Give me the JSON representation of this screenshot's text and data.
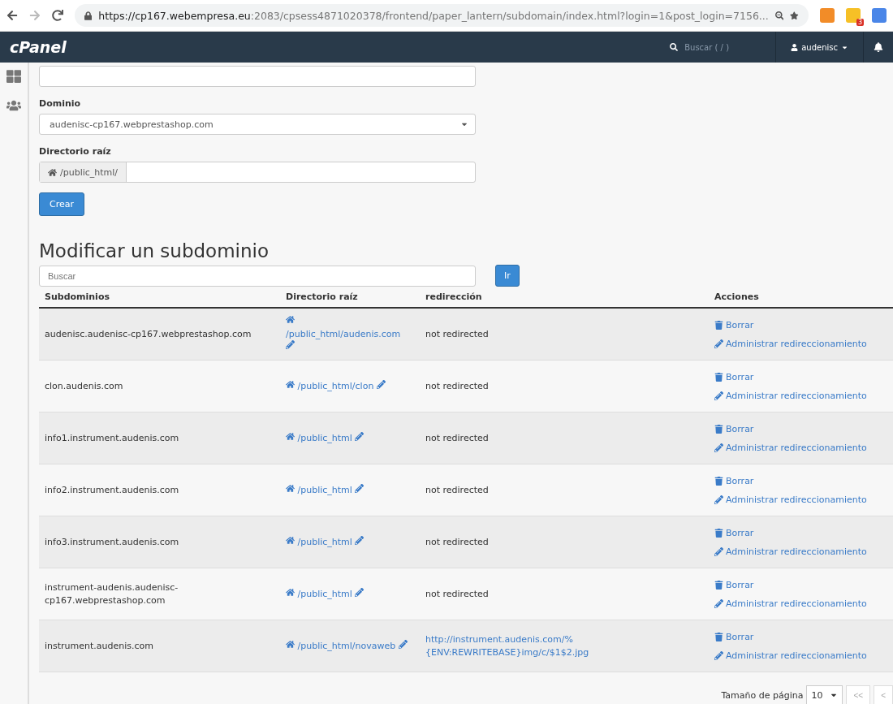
{
  "browser": {
    "url_host": "https://cp167.webempresa.eu",
    "url_path": ":2083/cpsess4871020378/frontend/paper_lantern/subdomain/index.html?login=1&post_login=7156...",
    "extension_badge": "3"
  },
  "header": {
    "logo": "cPanel",
    "search_placeholder": "Buscar ( / )",
    "user": "audenisc"
  },
  "create_form": {
    "domain_label": "Dominio",
    "domain_value": "audenisc-cp167.webprestashop.com",
    "root_label": "Directorio raíz",
    "root_prefix": "/public_html/",
    "submit": "Crear"
  },
  "modify": {
    "title": "Modificar un subdominio",
    "search_placeholder": "Buscar",
    "go": "Ir"
  },
  "table": {
    "columns": [
      "Subdominios",
      "Directorio raíz",
      "redirección",
      "Acciones"
    ],
    "rows": [
      {
        "subdomain": "audenisc.audenisc-cp167.webprestashop.com",
        "root": "/public_html/audenis.com",
        "redirect": {
          "kind": "plain",
          "text": "not redirected"
        },
        "delete": "Borrar",
        "manage": "Administrar redireccionamiento"
      },
      {
        "subdomain": "clon.audenis.com",
        "root": "/public_html/clon",
        "redirect": {
          "kind": "plain",
          "text": "not redirected"
        },
        "delete": "Borrar",
        "manage": "Administrar redireccionamiento"
      },
      {
        "subdomain": "info1.instrument.audenis.com",
        "root": "/public_html",
        "redirect": {
          "kind": "plain",
          "text": "not redirected"
        },
        "delete": "Borrar",
        "manage": "Administrar redireccionamiento"
      },
      {
        "subdomain": "info2.instrument.audenis.com",
        "root": "/public_html",
        "redirect": {
          "kind": "plain",
          "text": "not redirected"
        },
        "delete": "Borrar",
        "manage": "Administrar redireccionamiento"
      },
      {
        "subdomain": "info3.instrument.audenis.com",
        "root": "/public_html",
        "redirect": {
          "kind": "plain",
          "text": "not redirected"
        },
        "delete": "Borrar",
        "manage": "Administrar redireccionamiento"
      },
      {
        "subdomain": "instrument-audenis.audenisc-cp167.webprestashop.com",
        "root": "/public_html",
        "redirect": {
          "kind": "plain",
          "text": "not redirected"
        },
        "delete": "Borrar",
        "manage": "Administrar redireccionamiento"
      },
      {
        "subdomain": "instrument.audenis.com",
        "root": "/public_html/novaweb",
        "redirect": {
          "kind": "link",
          "text": "http://instrument.audenis.com/%{ENV:REWRITEBASE}img/c/$1$2.jpg"
        },
        "delete": "Borrar",
        "manage": "Administrar redireccionamiento"
      }
    ]
  },
  "pager": {
    "label": "Tamaño de página",
    "size": "10",
    "first": "<<",
    "prev": "<"
  }
}
